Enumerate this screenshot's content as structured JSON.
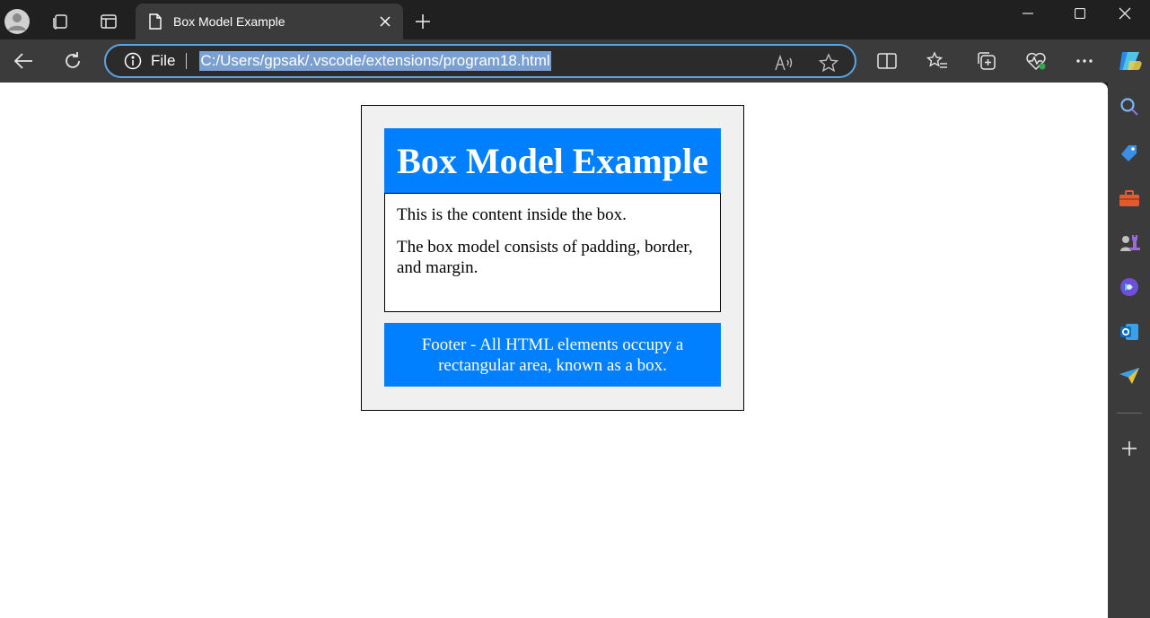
{
  "tab": {
    "title": "Box Model Example"
  },
  "address": {
    "scheme_label": "File",
    "url": "C:/Users/gpsak/.vscode/extensions/program18.html"
  },
  "page": {
    "heading": "Box Model Example",
    "paragraphs": [
      "This is the content inside the box.",
      "The box model consists of padding, border, and margin."
    ],
    "footer": "Footer - All HTML elements occupy a rectangular area, known as a box."
  },
  "colors": {
    "accent_blue": "#0080ff",
    "container_bg": "#f0f0f0",
    "url_highlight": "#7a9fd1"
  },
  "icons": {
    "titlebar": [
      "profile-avatar-icon",
      "workspaces-icon",
      "tab-actions-icon"
    ],
    "toolbar": [
      "back-icon",
      "refresh-icon",
      "read-aloud-icon",
      "favorite-star-icon",
      "split-screen-icon",
      "favorites-icon",
      "collections-icon",
      "browser-essentials-icon",
      "more-icon",
      "copilot-icon"
    ],
    "sidebar": [
      "search-icon",
      "shopping-icon",
      "tools-icon",
      "games-icon",
      "copilot-sidebar-icon",
      "outlook-icon",
      "send-icon",
      "add-icon"
    ]
  }
}
